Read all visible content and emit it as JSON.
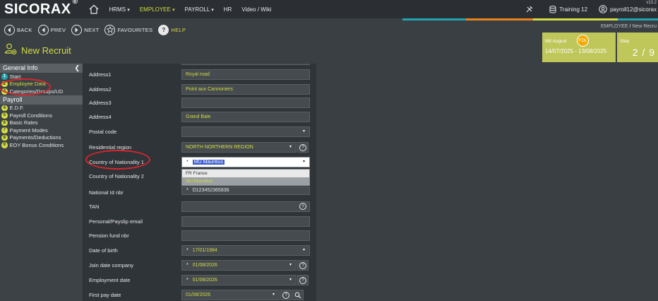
{
  "app": {
    "logo": "SICORAX",
    "logo_mark": "®",
    "version": "v13.2"
  },
  "nav": {
    "items": [
      {
        "label": "HRMS",
        "caret": "▾",
        "active": false
      },
      {
        "label": "EMPLOYEE",
        "caret": "▾",
        "active": true
      },
      {
        "label": "PAYROLL",
        "caret": "▾",
        "active": false
      },
      {
        "label": "HR",
        "caret": "",
        "active": false
      },
      {
        "label": "Video / Wiki",
        "caret": "",
        "active": false
      }
    ],
    "database": "Training 12",
    "user": "payroll12@sicorax"
  },
  "toolbar": {
    "back": "BACK",
    "prev": "PREV",
    "next": "NEXT",
    "favourites": "FAVOURITES",
    "help": "HELP"
  },
  "breadcrumb": {
    "section": "EMPLOYEE",
    "separator": "/",
    "page": "New Recru"
  },
  "page": {
    "title": "New Recruit"
  },
  "period": {
    "label": "M8 August",
    "badge": "FDL",
    "dates": "14/07/2025 - 13/08/2025"
  },
  "step": {
    "label": "Step",
    "value": "2 / 9"
  },
  "sidebar": {
    "general_header": "General Info",
    "collapse": "❮",
    "general_items": [
      {
        "n": "1",
        "label": "Start",
        "state": "done"
      },
      {
        "n": "2",
        "label": "Employee Data",
        "state": "current"
      },
      {
        "n": "3",
        "label": "Categories/Groups/UD",
        "state": "todo"
      }
    ],
    "payroll_header": "Payroll",
    "payroll_items": [
      {
        "n": "4",
        "label": "E.D.F."
      },
      {
        "n": "5",
        "label": "Payroll Conditions"
      },
      {
        "n": "6",
        "label": "Basic Rates"
      },
      {
        "n": "7",
        "label": "Payment Modes"
      },
      {
        "n": "8",
        "label": "Payments/Deductions"
      },
      {
        "n": "9",
        "label": "EOY Bonus Conditions"
      }
    ]
  },
  "form": {
    "address1": {
      "label": "Address1",
      "value": "Royal road"
    },
    "address2": {
      "label": "Address2",
      "value": "Point aux Cannoniers"
    },
    "address3": {
      "label": "Address3",
      "value": ""
    },
    "address4": {
      "label": "Address4",
      "value": "Grand Baie"
    },
    "postal_code": {
      "label": "Postal code",
      "value": ""
    },
    "region": {
      "label": "Residential region",
      "value": "NORTH NORTHERN REGION"
    },
    "nationality1": {
      "label": "Country of Nationality 1",
      "value": "MU Mauritius",
      "options": [
        "FR France",
        "MU Mauritius"
      ]
    },
    "nationality2": {
      "label": "Country of Nationality 2",
      "value": ""
    },
    "national_id": {
      "label": "National Id nbr",
      "value": "D123452365836"
    },
    "tan": {
      "label": "TAN",
      "value": ""
    },
    "email": {
      "label": "Personal/Payslip email",
      "value": ""
    },
    "pension": {
      "label": "Pension fund nbr",
      "value": ""
    },
    "dob": {
      "label": "Date of birth",
      "value": "17/01/1984"
    },
    "join_date": {
      "label": "Join date company",
      "value": "01/08/2026"
    },
    "employment_date": {
      "label": "Employment date",
      "value": "01/08/2026"
    },
    "first_pay_date": {
      "label": "First pay date",
      "value": "01/08/2026"
    },
    "required_mark": "*",
    "dropdown_glyph": "▾",
    "help_glyph": "?"
  },
  "colors": {
    "accent": "#d2dc42",
    "teal": "#21a3b0",
    "orange": "#e8831c",
    "annotation": "#d8262c",
    "card": "#bfc65a"
  }
}
